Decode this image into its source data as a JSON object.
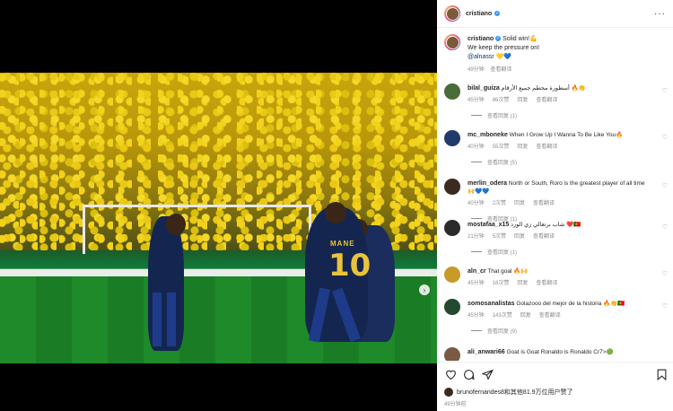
{
  "post": {
    "author": "cristiano",
    "caption_author": "cristiano",
    "caption_line1": "Solid win!💪",
    "caption_line2": "We keep the pressure on!",
    "caption_mention": "@alnassr",
    "caption_emoji": "💛💙",
    "caption_time": "49分钟",
    "caption_translate": "查看翻译",
    "more_label": "···"
  },
  "media": {
    "jersey_name": "MANE",
    "jersey_number": "10",
    "carousel_dots": 9,
    "active_dot": 1
  },
  "comments": [
    {
      "user": "bilal_guiza",
      "text": "أسطورة محطم جميع الأرقام 🔥👏",
      "time": "45分钟",
      "likes": "86次赞",
      "reply": "回复",
      "translate": "查看翻译",
      "view_replies": "查看回复 (1)"
    },
    {
      "user": "mc_mboneke",
      "text": "When I Grow Up I Wanna To Be Like You🔥",
      "time": "40分钟",
      "likes": "55次赞",
      "reply": "回复",
      "translate": "查看翻译",
      "view_replies": "查看回复 (5)"
    },
    {
      "user": "merlin_odera",
      "text": "North or South, Roro is the greatest player of all time 🙌💙💙",
      "time": "40分钟",
      "likes": "2次赞",
      "reply": "回复",
      "translate": "查看翻译",
      "view_replies": "查看回复 (1)"
    },
    {
      "user": "mostafaa_x15",
      "text": "شاب برتغالي زي الورد ❤️🇵🇹",
      "time": "21分钟",
      "likes": "5次赞",
      "reply": "回复",
      "translate": "查看翻译",
      "view_replies": "查看回复 (1)"
    },
    {
      "user": "aln_cr",
      "text": "That goal 🔥🙌",
      "time": "45分钟",
      "likes": "16次赞",
      "reply": "回复",
      "translate": "查看翻译",
      "view_replies": ""
    },
    {
      "user": "somosanalistas",
      "text": "Golazooo del mejor de la historia 🔥👏🇵🇹",
      "time": "45分钟",
      "likes": "143次赞",
      "reply": "回复",
      "translate": "查看翻译",
      "view_replies": "查看回复 (9)"
    },
    {
      "user": "ali_anwari66",
      "text": "Goat is Goat Ronaldo is Ronaldo Cr7>🟢",
      "time": "",
      "likes": "",
      "reply": "",
      "translate": "",
      "view_replies": ""
    }
  ],
  "actions": {
    "like_icon": "heart-icon",
    "comment_icon": "comment-icon",
    "share_icon": "share-icon",
    "save_icon": "bookmark-icon"
  },
  "likes_text": "brunofernandes8和其他81.9万位用户赞了",
  "posted_time": "49分钟前",
  "colors": {
    "link": "#00376b",
    "verified": "#3897f0",
    "meta": "#8e8e8e"
  }
}
